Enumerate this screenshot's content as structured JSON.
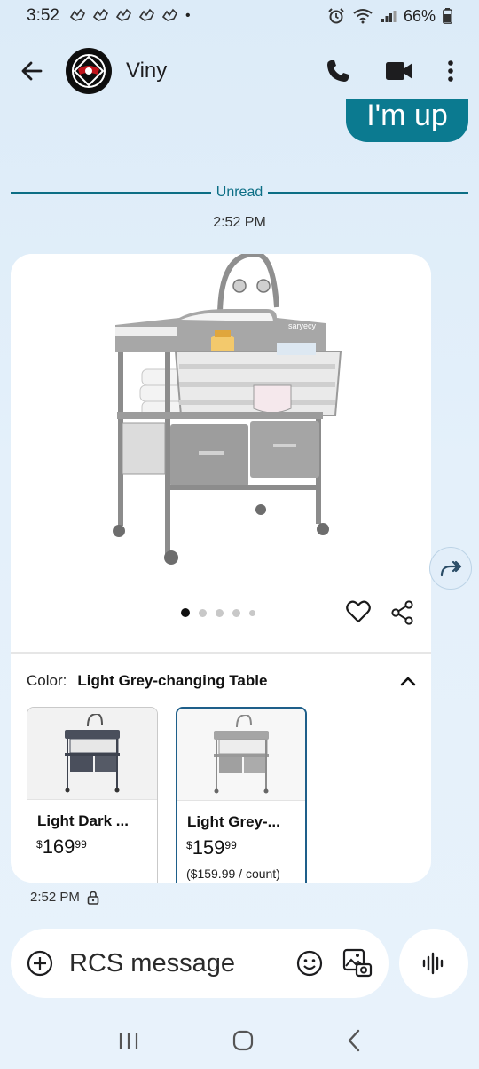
{
  "status_bar": {
    "time": "3:52",
    "notification_icons": [
      "bird-icon",
      "bird-icon",
      "bird-icon",
      "bird-icon",
      "bird-icon"
    ],
    "dot": "•",
    "battery": "66%"
  },
  "header": {
    "contact_name": "Viny"
  },
  "thread": {
    "sent_message_partial": "I'm up",
    "unread_label": "Unread",
    "timestamp": "2:52 PM"
  },
  "product_card": {
    "brand_on_image": "saryecy",
    "image_count": 5,
    "active_image_index": 0,
    "color_label": "Color:",
    "color_value": "Light Grey-changing Table",
    "variants": [
      {
        "name": "Light Dark ...",
        "price_symbol": "$",
        "price_whole": "169",
        "price_cents": "99",
        "unit_price": "",
        "selected": false
      },
      {
        "name": "Light Grey-...",
        "price_symbol": "$",
        "price_whole": "159",
        "price_cents": "99",
        "unit_price": "($159.99 / count)",
        "selected": true
      }
    ]
  },
  "message_meta": {
    "time": "2:52 PM"
  },
  "composer": {
    "placeholder": "RCS message"
  },
  "colors": {
    "accent": "#0b7a90",
    "unread_line": "#0b6e85",
    "selected_border": "#1e5f8a",
    "background": "#dcebf8"
  }
}
